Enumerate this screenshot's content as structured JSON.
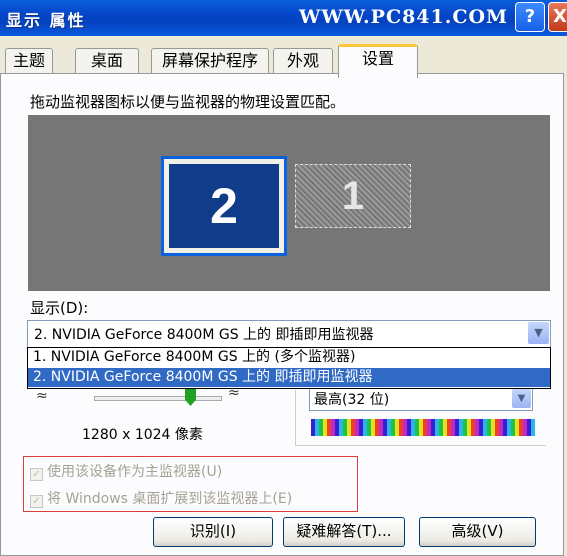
{
  "window": {
    "title": "显示 属性",
    "watermark": "WWW.PC841.COM",
    "help_label": "?",
    "close_label": "X"
  },
  "tabs": [
    {
      "label": "主题"
    },
    {
      "label": "桌面"
    },
    {
      "label": "屏幕保护程序"
    },
    {
      "label": "外观"
    },
    {
      "label": "设置"
    }
  ],
  "settings": {
    "instruction": "拖动监视器图标以便与监视器的物理设置匹配。",
    "monitors": [
      {
        "number": "2",
        "selected": true
      },
      {
        "number": "1",
        "selected": false
      }
    ],
    "display_label": "显示(D):",
    "display_value": "2. NVIDIA GeForce 8400M GS 上的 即插即用监视器",
    "dropdown_options": [
      "1. NVIDIA GeForce 8400M GS 上的 (多个监视器)",
      "2. NVIDIA GeForce 8400M GS 上的 即插即用监视器"
    ],
    "resolution": "1280 x 1024 像素",
    "resolution_position": 0.72,
    "color_quality": "最高(32 位)",
    "checkboxes": [
      {
        "label": "使用该设备作为主监视器(U)",
        "checked": true
      },
      {
        "label": "将 Windows 桌面扩展到该监视器上(E)",
        "checked": true
      }
    ],
    "buttons": {
      "identify": "识别(I)",
      "troubleshoot": "疑难解答(T)...",
      "advanced": "高级(V)"
    }
  },
  "colors": {
    "title_bar": "#0A5FDB",
    "selection": "#316AC5",
    "monitor_selected": "#113C8A",
    "highlight_border": "#DE3B3B"
  },
  "icons": {
    "dropdown": "chevron-down-icon",
    "check": "checkmark-icon"
  }
}
